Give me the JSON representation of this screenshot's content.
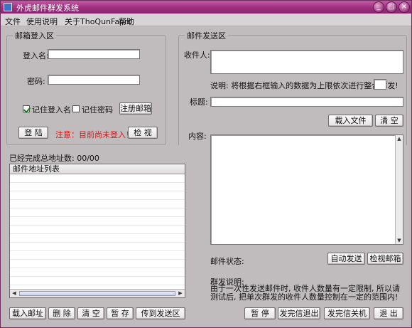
{
  "window": {
    "title": "外虎邮件群发系统",
    "controls": [
      "_",
      "□",
      "×"
    ]
  },
  "menu": [
    "文件",
    "使用说明",
    "关于ThoQunFapro",
    "帮助"
  ],
  "login": {
    "group_title": "邮箱登入区",
    "username_label": "登入名:",
    "username_value": "",
    "password_label": "密码:",
    "password_value": "",
    "remember_name_label": "记住登入名",
    "remember_name_checked": true,
    "remember_pass_label": "记住密码",
    "remember_pass_checked": false,
    "register_button": "注册邮箱",
    "login_button": "登 陆",
    "status_text": "注意：目前尚未登入！",
    "check_button": "检 视"
  },
  "address_area": {
    "completed_label": "已经完成总地址数: 00/00",
    "list_header": "邮件地址列表",
    "buttons": [
      "载入邮址",
      "删 除",
      "清 空",
      "暂 存",
      "传到发送区"
    ]
  },
  "send": {
    "group_title": "邮件发送区",
    "recipient_label": "收件人:",
    "recipient_value": "",
    "note_text": "说明: 将根据右框输入的数据为上限依次进行整合群发!",
    "limit_value": "",
    "subject_label": "标题:",
    "subject_value": "",
    "load_file_button": "载入文件",
    "clear_button": "清 空",
    "content_label": "内容:",
    "content_value": "",
    "status_label": "邮件状态:",
    "auto_send_button": "自动发送",
    "view_mailbox_button": "检视邮箱",
    "group_note_title": "群发说明:",
    "group_note_text": "由于一次性发送邮件时, 收件人数量有一定限制, 所以请测试后, 把单次群发的收件人数量控制在一定的范围内!",
    "bottom_buttons": [
      "暂 停",
      "发完信退出",
      "发完信关机",
      "退 出"
    ]
  }
}
